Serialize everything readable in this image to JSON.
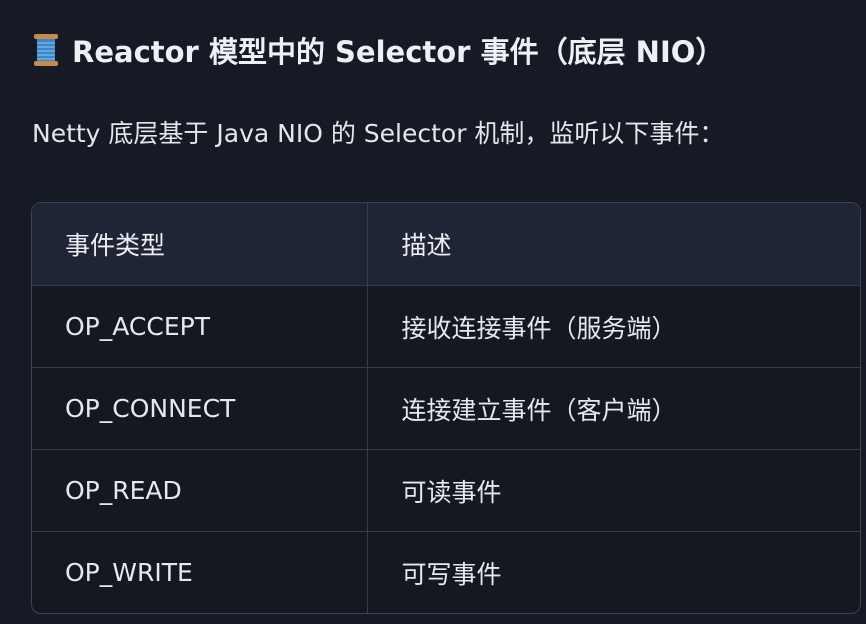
{
  "heading": {
    "icon": "thread-spool-icon",
    "text": "Reactor 模型中的 Selector 事件（底层 NIO）"
  },
  "intro": "Netty 底层基于 Java NIO 的 Selector 机制，监听以下事件：",
  "table": {
    "headers": [
      "事件类型",
      "描述"
    ],
    "rows": [
      {
        "type": "OP_ACCEPT",
        "desc": "接收连接事件（服务端）"
      },
      {
        "type": "OP_CONNECT",
        "desc": "连接建立事件（客户端）"
      },
      {
        "type": "OP_READ",
        "desc": "可读事件"
      },
      {
        "type": "OP_WRITE",
        "desc": "可写事件"
      }
    ]
  },
  "colors": {
    "background": "#151a25",
    "header_row": "#1f2535",
    "border": "#343b4a",
    "text": "#e6e8ed"
  }
}
